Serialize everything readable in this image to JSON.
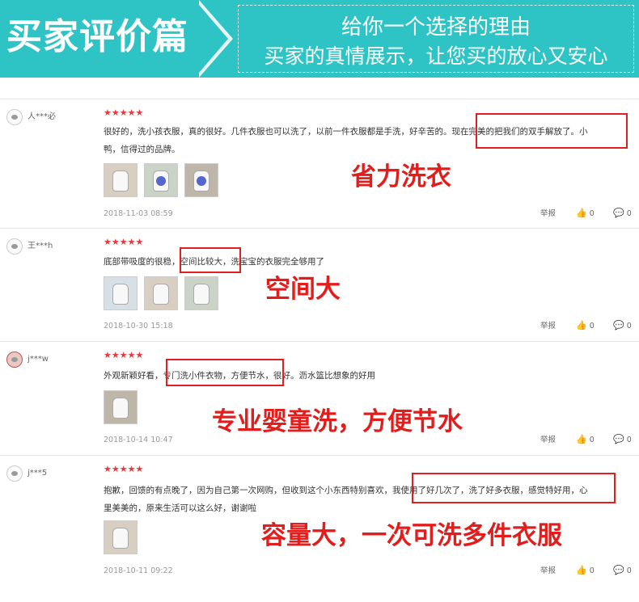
{
  "banner": {
    "title": "买家评价篇",
    "line1": "给你一个选择的理由",
    "line2": "买家的真情展示，让您买的放心又安心"
  },
  "actions": {
    "report": "举报",
    "like_icon": "thumbs-up-icon",
    "comment_icon": "comment-icon"
  },
  "colors": {
    "banner": "#2ec4c6",
    "accent_red": "#e31c1c",
    "star": "#e4393c"
  },
  "reviews": [
    {
      "user": "人***必",
      "stars": "★★★★★",
      "line1": "很好的，洗小孩衣服，真的很好。几件衣服也可以洗了，以前一件衣服都是手洗，好辛苦的。现在完美的把我们的双手解放了。小",
      "line2": "鸭，信得过的品牌。",
      "date": "2018-11-03 08:59",
      "likes": "0",
      "comments": "0",
      "callout": "省力洗衣"
    },
    {
      "user": "王***h",
      "stars": "★★★★★",
      "line1": "底部带吸度的很稳，空间比较大，洗宝宝的衣服完全够用了",
      "date": "2018-10-30 15:18",
      "likes": "0",
      "comments": "0",
      "callout": "空间大"
    },
    {
      "user": "j***w",
      "stars": "★★★★★",
      "line1": "外观新颖好看，专门洗小件衣物，方便节水，很好。沥水篮比想象的好用",
      "date": "2018-10-14 10:47",
      "likes": "0",
      "comments": "0",
      "callout": "专业婴童洗，方便节水"
    },
    {
      "user": "j***5",
      "stars": "★★★★★",
      "line1": "抱歉，回馈的有点晚了，因为自己第一次网购，但收到这个小东西特别喜欢，我使用了好几次了，洗了好多衣服，感觉特好用，心",
      "line2": "里美美的，原来生活可以这么好，谢谢啦",
      "date": "2018-10-11 09:22",
      "likes": "0",
      "comments": "0",
      "callout": "容量大，一次可洗多件衣服"
    }
  ]
}
